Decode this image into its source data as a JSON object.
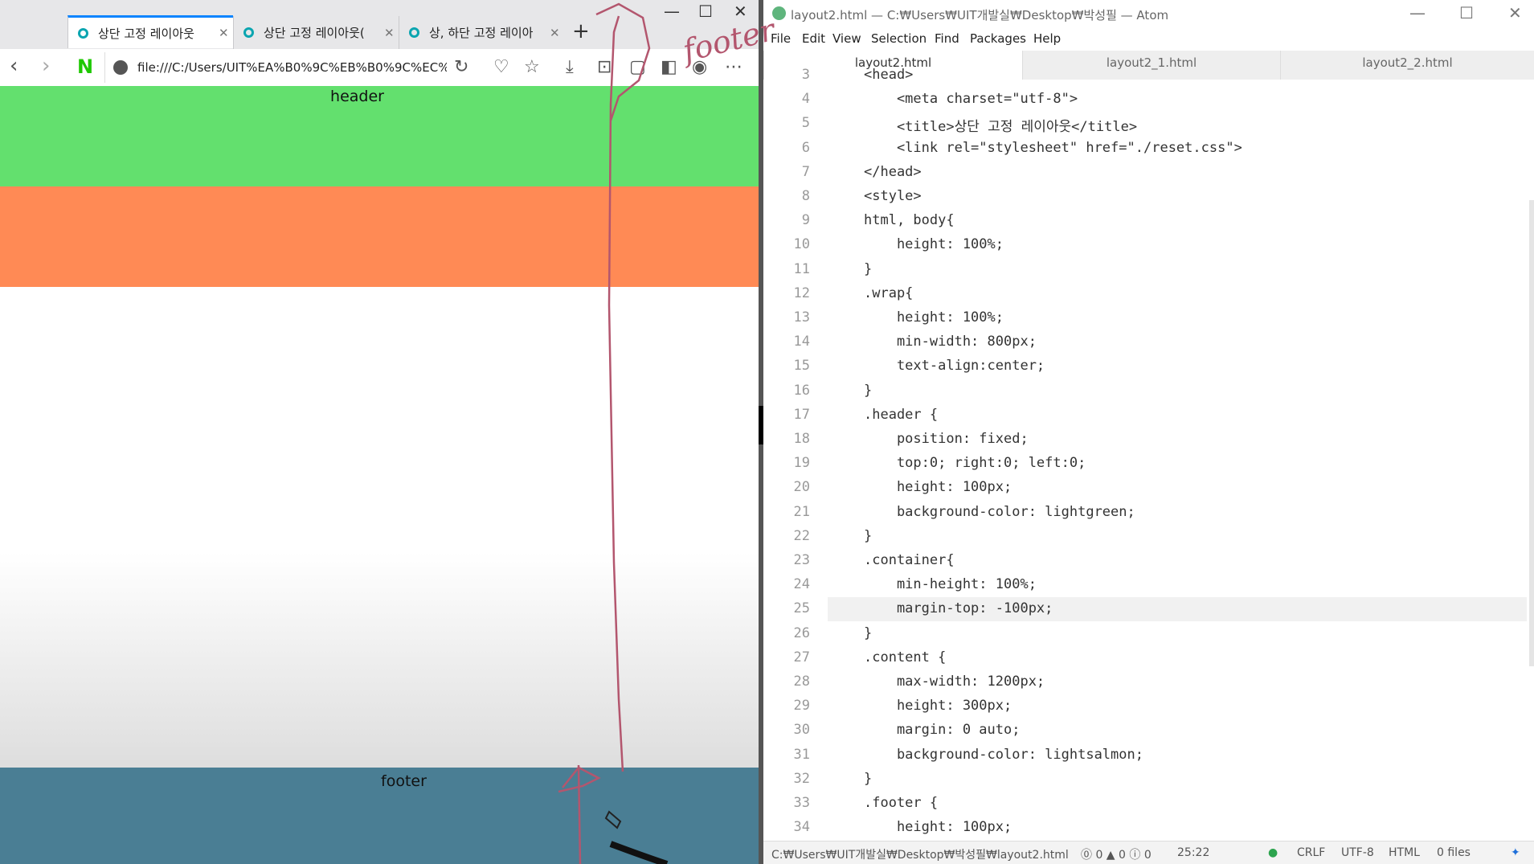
{
  "browser": {
    "tabs": [
      {
        "title": "상단 고정 레이아웃"
      },
      {
        "title": "상단 고정 레이아웃("
      },
      {
        "title": "상, 하단 고정 레이아"
      }
    ],
    "url": "file:///C:/Users/UIT%EA%B0%9C%EB%B0%9C%EC%",
    "page": {
      "header_text": "header",
      "footer_text": "footer",
      "colors": {
        "header": "#63e06e",
        "content": "#ff8a55",
        "footer": "#4a7e94"
      }
    }
  },
  "atom": {
    "title": "layout2.html — C:₩Users₩UIT개발실₩Desktop₩박성필 — Atom",
    "menu": [
      "File",
      "Edit",
      "View",
      "Selection",
      "Find",
      "Packages",
      "Help"
    ],
    "tabs": [
      {
        "label": "layout2.html",
        "active": true
      },
      {
        "label": "layout2_1.html",
        "active": false
      },
      {
        "label": "layout2_2.html",
        "active": false
      }
    ],
    "highlighted_line": 25,
    "status": {
      "path": "C:₩Users₩UIT개발실₩Desktop₩박성필₩layout2.html",
      "diagnostics": "⓪ 0 ▲ 0 ⓘ 0",
      "cursor": "25:22",
      "line_ending": "CRLF",
      "encoding": "UTF-8",
      "grammar": "HTML",
      "files": "0 files"
    }
  },
  "code_lines": [
    {
      "n": 3,
      "text": "<head>"
    },
    {
      "n": 4,
      "text": "    <meta charset=\"utf-8\">"
    },
    {
      "n": 5,
      "text": "    <title>상단 고정 레이아웃</title>"
    },
    {
      "n": 6,
      "text": "    <link rel=\"stylesheet\" href=\"./reset.css\">"
    },
    {
      "n": 7,
      "text": "</head>"
    },
    {
      "n": 8,
      "text": "<style>"
    },
    {
      "n": 9,
      "text": "html, body{"
    },
    {
      "n": 10,
      "text": "    height: 100%;"
    },
    {
      "n": 11,
      "text": "}"
    },
    {
      "n": 12,
      "text": ".wrap{"
    },
    {
      "n": 13,
      "text": "    height: 100%;"
    },
    {
      "n": 14,
      "text": "    min-width: 800px;"
    },
    {
      "n": 15,
      "text": "    text-align:center;"
    },
    {
      "n": 16,
      "text": "}"
    },
    {
      "n": 17,
      "text": ".header {"
    },
    {
      "n": 18,
      "text": "    position: fixed;"
    },
    {
      "n": 19,
      "text": "    top:0; right:0; left:0;"
    },
    {
      "n": 20,
      "text": "    height: 100px;"
    },
    {
      "n": 21,
      "text": "    background-color: lightgreen;"
    },
    {
      "n": 22,
      "text": "}"
    },
    {
      "n": 23,
      "text": ".container{"
    },
    {
      "n": 24,
      "text": "    min-height: 100%;"
    },
    {
      "n": 25,
      "text": "    margin-top: -100px;"
    },
    {
      "n": 26,
      "text": "}"
    },
    {
      "n": 27,
      "text": ".content {"
    },
    {
      "n": 28,
      "text": "    max-width: 1200px;"
    },
    {
      "n": 29,
      "text": "    height: 300px;"
    },
    {
      "n": 30,
      "text": "    margin: 0 auto;"
    },
    {
      "n": 31,
      "text": "    background-color: lightsalmon;"
    },
    {
      "n": 32,
      "text": "}"
    },
    {
      "n": 33,
      "text": ".footer {"
    },
    {
      "n": 34,
      "text": "    height: 100px;"
    }
  ],
  "handwriting": "footer"
}
